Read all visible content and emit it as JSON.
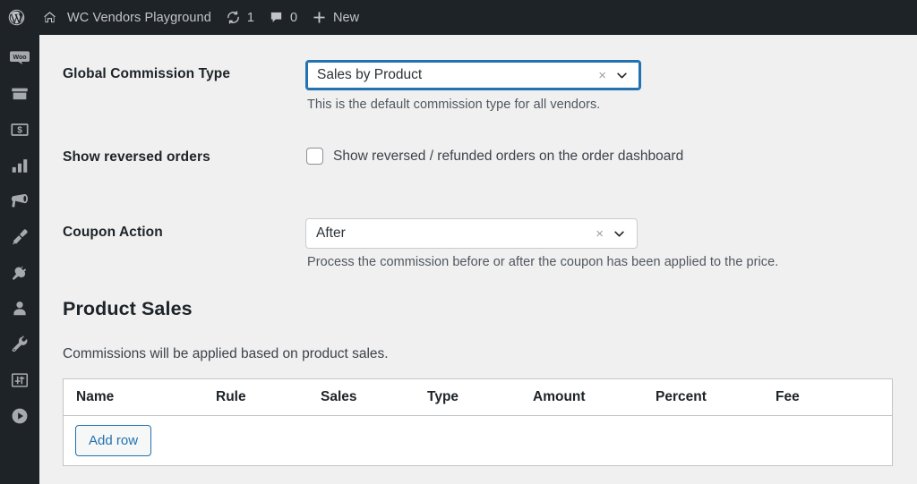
{
  "adminbar": {
    "wp_logo_icon": "wordpress-logo-icon",
    "home_icon": "home-icon",
    "site_name": "WC Vendors Playground",
    "updates_icon": "updates-icon",
    "updates_count": "1",
    "comments_icon": "comments-icon",
    "comments_count": "0",
    "new_icon": "plus-icon",
    "new_label": "New"
  },
  "adminmenu": {
    "items": [
      {
        "icon": "woocommerce-icon",
        "name": "woocommerce"
      },
      {
        "icon": "products-box-icon",
        "name": "products"
      },
      {
        "icon": "payments-icon",
        "name": "payments"
      },
      {
        "icon": "analytics-bar-chart-icon",
        "name": "analytics"
      },
      {
        "icon": "marketing-megaphone-icon",
        "name": "marketing"
      },
      {
        "icon": "appearance-brush-icon",
        "name": "appearance"
      },
      {
        "icon": "plugins-plug-icon",
        "name": "plugins"
      },
      {
        "icon": "users-person-icon",
        "name": "users"
      },
      {
        "icon": "tools-wrench-icon",
        "name": "tools"
      },
      {
        "icon": "settings-sliders-icon",
        "name": "settings"
      },
      {
        "icon": "media-play-icon",
        "name": "media"
      }
    ]
  },
  "form": {
    "commission_type": {
      "label": "Global Commission Type",
      "value": "Sales by Product",
      "clear_icon": "clear-x-icon",
      "dropdown_icon": "chevron-down-icon",
      "help": "This is the default commission type for all vendors.",
      "focused": true
    },
    "reversed_orders": {
      "label": "Show reversed orders",
      "checkbox_label": "Show reversed / refunded orders on the order dashboard",
      "checked": false
    },
    "coupon_action": {
      "label": "Coupon Action",
      "value": "After",
      "clear_icon": "clear-x-icon",
      "dropdown_icon": "chevron-down-icon",
      "help": "Process the commission before or after the coupon has been applied to the price.",
      "focused": false
    }
  },
  "product_sales": {
    "title": "Product Sales",
    "description": "Commissions will be applied based on product sales.",
    "columns": [
      "Name",
      "Rule",
      "Sales",
      "Type",
      "Amount",
      "Percent",
      "Fee"
    ],
    "rows": [],
    "add_row_label": "Add row"
  },
  "colors": {
    "admin_dark": "#1d2327",
    "content_bg": "#f0f0f1",
    "accent_blue": "#2271b1",
    "border_gray": "#c3c4c7",
    "text_dark": "#1d2327",
    "text_muted": "#50575e"
  }
}
